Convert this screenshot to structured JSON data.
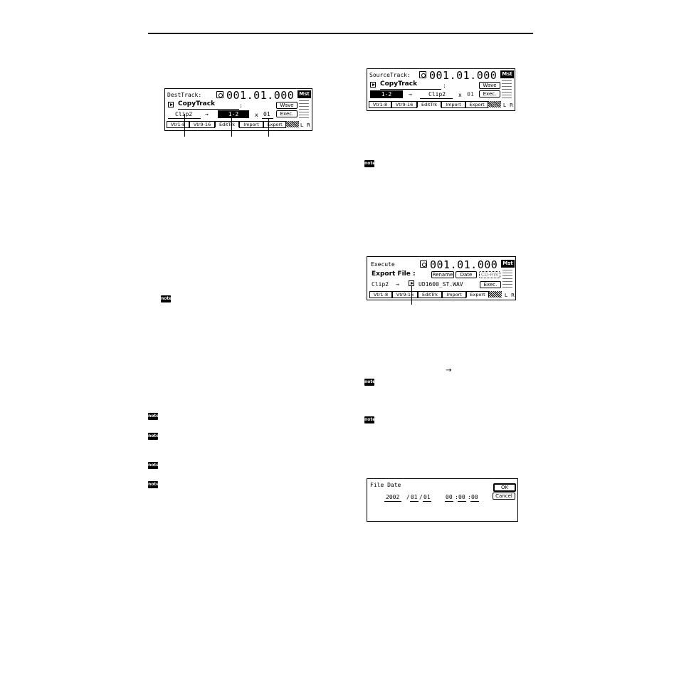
{
  "screens": {
    "s1": {
      "label": "DestTrack:",
      "time": "001.01.000",
      "mst": "Mst",
      "func": "CopyTrack",
      "colon": ":",
      "wave_btn": "Wave",
      "exec_btn": "Exec.",
      "src": "Clip2",
      "arrow": "→",
      "dest": "1-2",
      "times_sym": "x",
      "times": "01",
      "tabs": [
        "Vtr1-8",
        "Vtr9-16",
        "EditTrk",
        "Import",
        "Export"
      ],
      "l": "L",
      "r": "R"
    },
    "s2": {
      "label": "SourceTrack:",
      "time": "001.01.000",
      "mst": "Mst",
      "func": "CopyTrack",
      "colon": ":",
      "wave_btn": "Wave",
      "exec_btn": "Exec.",
      "src": "1-2",
      "arrow": "→",
      "dest": "Clip2",
      "times_sym": "x",
      "times": "01",
      "tabs": [
        "Vtr1-8",
        "Vtr9-16",
        "EditTrk",
        "Import",
        "Export"
      ],
      "l": "L",
      "r": "R"
    },
    "s3": {
      "label": "Execute",
      "time": "001.01.000",
      "mst": "Mst",
      "func": "Export File :",
      "rename_btn": "Rename",
      "date_btn": "Date",
      "cd_btn": "CD-RW",
      "exec_btn": "Exec.",
      "src": "Clip2",
      "arrow": "→",
      "filename": "UD1600_ST.WAV",
      "tabs": [
        "Vtr1-8",
        "Vtr9-16",
        "EditTrk",
        "Import",
        "Export"
      ],
      "l": "L",
      "r": "R"
    },
    "s4": {
      "label": "File Date",
      "ok_btn": "OK",
      "cancel_btn": "Cancel",
      "year": "2002",
      "month": "01",
      "day": "01",
      "hour": "00",
      "minute": "00",
      "second": "00",
      "sep_date": "/",
      "sep_time": ":"
    }
  },
  "note_label": "note",
  "arrow_symbol": "→"
}
